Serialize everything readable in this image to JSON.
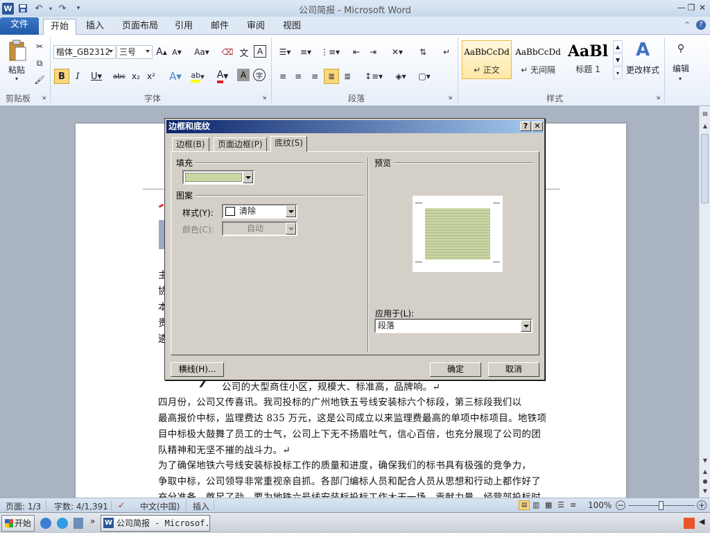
{
  "window": {
    "title": "公司简报 - Microsoft Word",
    "app_icon": "W"
  },
  "tabs": {
    "file": "文件",
    "home": "开始",
    "insert": "插入",
    "layout": "页面布局",
    "references": "引用",
    "mailings": "邮件",
    "review": "审阅",
    "view": "视图"
  },
  "ribbon": {
    "clipboard": {
      "paste": "粘贴",
      "label": "剪贴板"
    },
    "font": {
      "name": "楷体_GB2312",
      "size": "三号",
      "grow": "A",
      "shrink": "A",
      "case": "Aa",
      "wen": "A",
      "bold": "B",
      "italic": "I",
      "underline": "U",
      "strike": "abc",
      "sub": "x₂",
      "sup": "x²",
      "effect": "A",
      "highlight": "ab",
      "color": "A",
      "shade": "A",
      "circle": "字",
      "label": "字体"
    },
    "paragraph": {
      "label": "段落"
    },
    "styles": {
      "items": [
        {
          "sample": "AaBbCcDd",
          "name": "↵ 正文"
        },
        {
          "sample": "AaBbCcDd",
          "name": "↵ 无间隔"
        },
        {
          "sample": "AaBl",
          "name": "标题 1"
        }
      ],
      "change": "更改样式",
      "label": "样式"
    },
    "editing": {
      "label": "编辑"
    }
  },
  "dialog": {
    "title": "边框和底纹",
    "help": "?",
    "close": "✕",
    "tabs": [
      "边框(B)",
      "页面边框(P)",
      "底纹(S)"
    ],
    "fill_label": "填充",
    "fill_color": "#c9d6a3",
    "pattern_label": "图案",
    "style_label": "样式(Y):",
    "style_value": "清除",
    "color_label": "颜色(C):",
    "color_value": "自动",
    "preview_label": "预览",
    "apply_label": "应用于(L):",
    "apply_value": "段落",
    "hline_button": "横线(H)...",
    "ok_button": "确定",
    "cancel_button": "取消"
  },
  "document": {
    "fragments": [
      "主",
      "协",
      "本",
      "贵",
      "遴"
    ],
    "lines": [
      "公司的大型商住小区，规模大、标准高，品牌响。↵",
      "    四月份，公司又传喜讯。我司投标的广州地铁五号线安装标六个标段，第三标段我们以",
      "最高报价中标，监理费达 835 万元，这是公司成立以来监理费最高的单项中标项目。地铁项",
      "目中标极大鼓舞了员工的士气，公司上下无不扬眉吐气，信心百倍，也充分展现了公司的团",
      "队精神和无坚不摧的战斗力。↵",
      "    为了确保地铁六号线安装标投标工作的质量和进度，确保我们的标书具有极强的竞争力，",
      "争取中标，公司领导非常重视亲自抓。各部门编标人员和配合人员从思想和行动上都作好了",
      "充分准备，憋足了劲，要为地铁六号线安装标投标工作大干一场，贡献力量。经营部投标时，"
    ]
  },
  "statusbar": {
    "page": "页面: 1/3",
    "words": "字数: 4/1,391",
    "language": "中文(中国)",
    "mode": "插入",
    "zoom": "100%"
  },
  "taskbar": {
    "start": "开始",
    "task": "公司简报 - Microsof..."
  }
}
